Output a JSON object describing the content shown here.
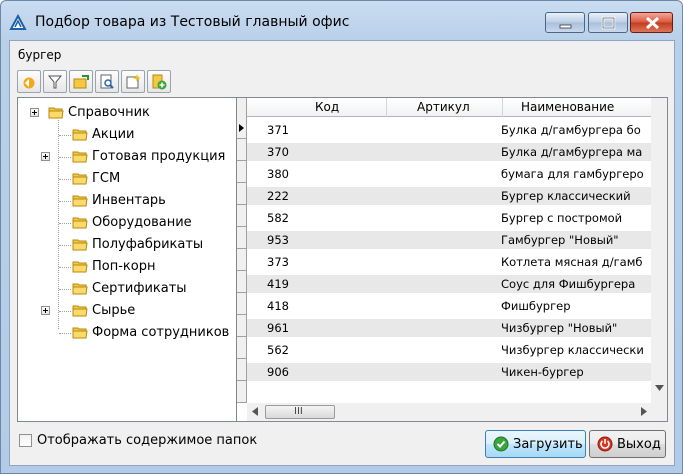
{
  "window": {
    "title": "Подбор товара из Тестовый главный офис"
  },
  "search": {
    "value": "бургер"
  },
  "toolbar": {
    "buttons": [
      "refresh-icon",
      "filter-icon",
      "edit-folder-icon",
      "preview-icon",
      "new-item-icon",
      "add-icon"
    ]
  },
  "tree": {
    "root": "Справочник",
    "items": [
      {
        "label": "Акции",
        "expandable": false
      },
      {
        "label": "Готовая продукция",
        "expandable": true
      },
      {
        "label": "ГСМ",
        "expandable": false
      },
      {
        "label": "Инвентарь",
        "expandable": false
      },
      {
        "label": "Оборудование",
        "expandable": false
      },
      {
        "label": "Полуфабрикаты",
        "expandable": false
      },
      {
        "label": "Поп-корн",
        "expandable": false
      },
      {
        "label": "Сертификаты",
        "expandable": false
      },
      {
        "label": "Сырье",
        "expandable": true
      },
      {
        "label": "Форма сотрудников",
        "expandable": false
      }
    ]
  },
  "grid": {
    "columns": [
      "Код",
      "Артикул",
      "Наименование"
    ],
    "rows": [
      {
        "code": "371",
        "article": "",
        "name": "Булка д/гамбургера бо"
      },
      {
        "code": "370",
        "article": "",
        "name": "Булка д/гамбургера ма"
      },
      {
        "code": "380",
        "article": "",
        "name": "бумага для гамбургеро"
      },
      {
        "code": "222",
        "article": "",
        "name": "Бургер классический"
      },
      {
        "code": "582",
        "article": "",
        "name": "Бургер с постромой"
      },
      {
        "code": "953",
        "article": "",
        "name": "Гамбургер \"Новый\""
      },
      {
        "code": "373",
        "article": "",
        "name": "Котлета мясная д/гамб"
      },
      {
        "code": "419",
        "article": "",
        "name": "Соус для Фишбургера"
      },
      {
        "code": "418",
        "article": "",
        "name": "Фишбургер"
      },
      {
        "code": "961",
        "article": "",
        "name": "Чизбургер \"Новый\""
      },
      {
        "code": "562",
        "article": "",
        "name": "Чизбургер классически"
      },
      {
        "code": "906",
        "article": "",
        "name": "Чикен-бургер"
      }
    ],
    "hscroll_glyph": "III"
  },
  "footer": {
    "show_folder_contents_label": "Отображать содержимое папок",
    "show_folder_contents_checked": false,
    "load_label": "Загрузить",
    "exit_label": "Выход"
  },
  "colors": {
    "title_gradient": "#c9dcf0",
    "close_button": "#c33c21",
    "folder": "#f5c842",
    "row_alt": "#e8e8e8"
  }
}
